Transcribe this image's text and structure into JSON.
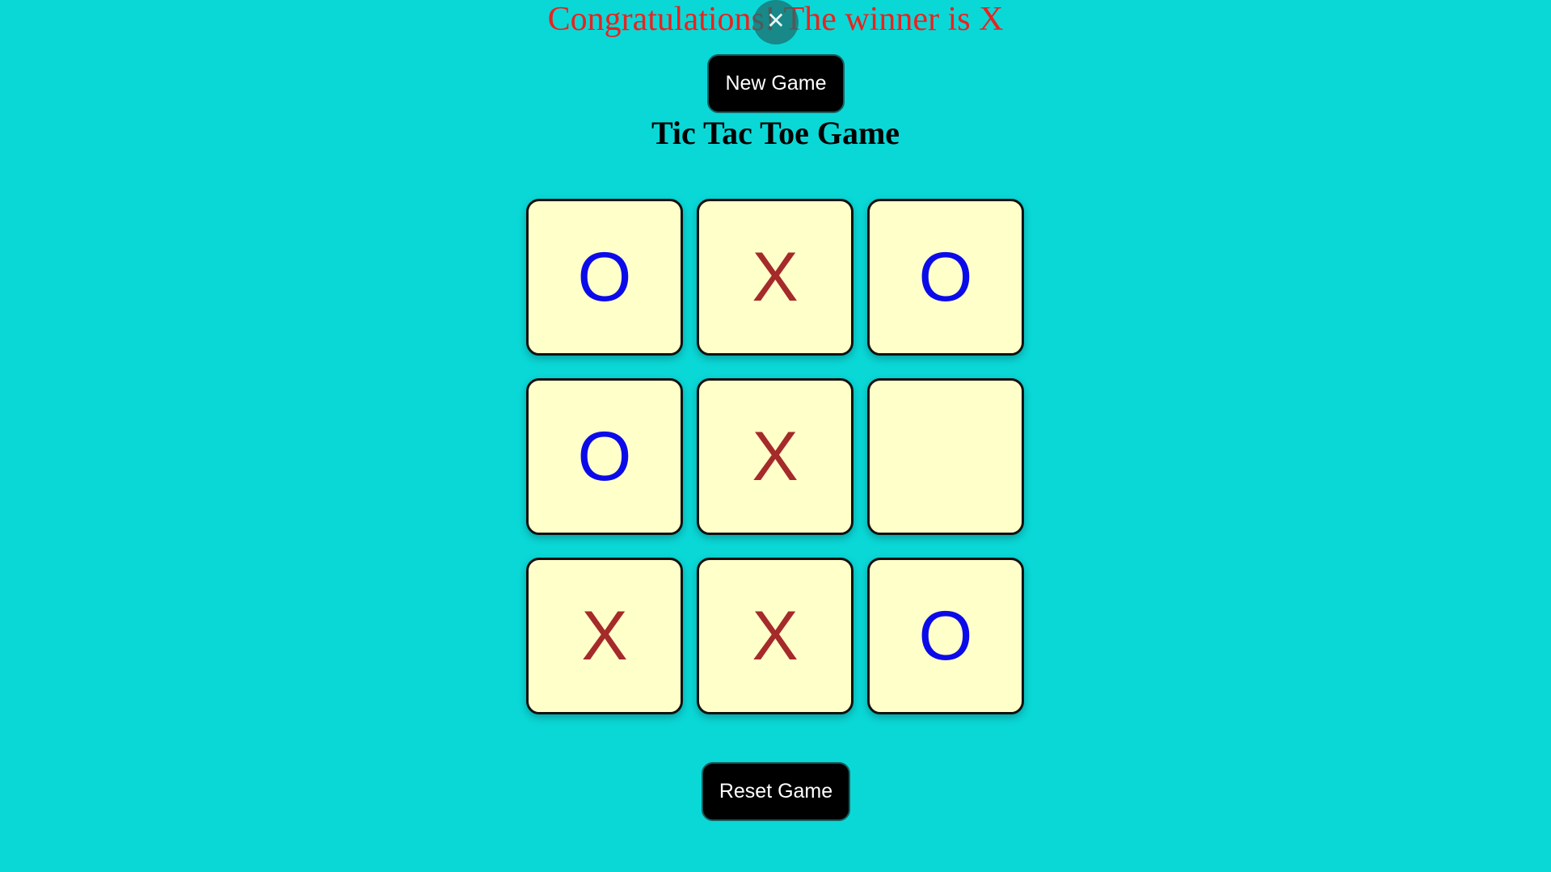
{
  "message": {
    "text": "Congratulations! The winner is X",
    "color": "#e8231f"
  },
  "close": {
    "glyph": "✕",
    "icon": "close-icon"
  },
  "new_game_label": "New Game",
  "title": "Tic Tac Toe Game",
  "board": {
    "cells": [
      "O",
      "X",
      "O",
      "O",
      "X",
      "",
      "X",
      "X",
      "O"
    ],
    "x_color": "#a52a2a",
    "o_color": "#0b0bea",
    "cell_bg": "#ffffc9"
  },
  "reset_game_label": "Reset Game",
  "background_color": "#0ad8d7"
}
